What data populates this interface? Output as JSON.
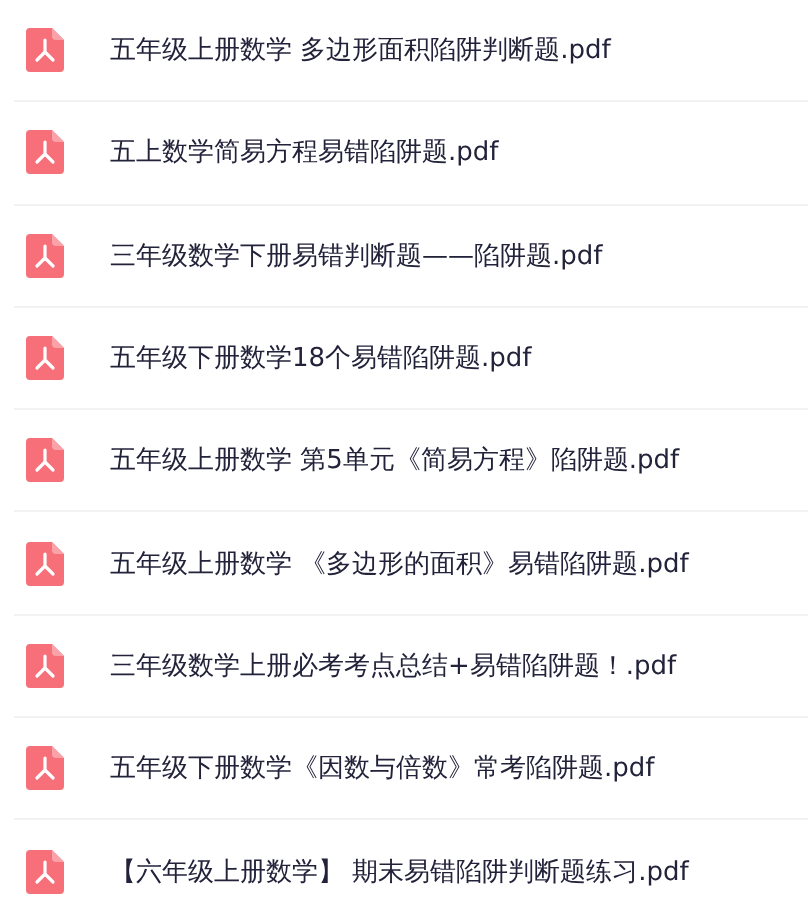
{
  "files": [
    {
      "name": "五年级上册数学 多边形面积陷阱判断题.pdf"
    },
    {
      "name": "五上数学简易方程易错陷阱题.pdf"
    },
    {
      "name": "三年级数学下册易错判断题——陷阱题.pdf"
    },
    {
      "name": "五年级下册数学18个易错陷阱题.pdf"
    },
    {
      "name": "五年级上册数学 第5单元《简易方程》陷阱题.pdf"
    },
    {
      "name": "五年级上册数学 《多边形的面积》易错陷阱题.pdf"
    },
    {
      "name": "三年级数学上册必考考点总结+易错陷阱题！.pdf"
    },
    {
      "name": "五年级下册数学《因数与倍数》常考陷阱题.pdf"
    },
    {
      "name": "【六年级上册数学】 期末易错陷阱判断题练习.pdf"
    }
  ]
}
